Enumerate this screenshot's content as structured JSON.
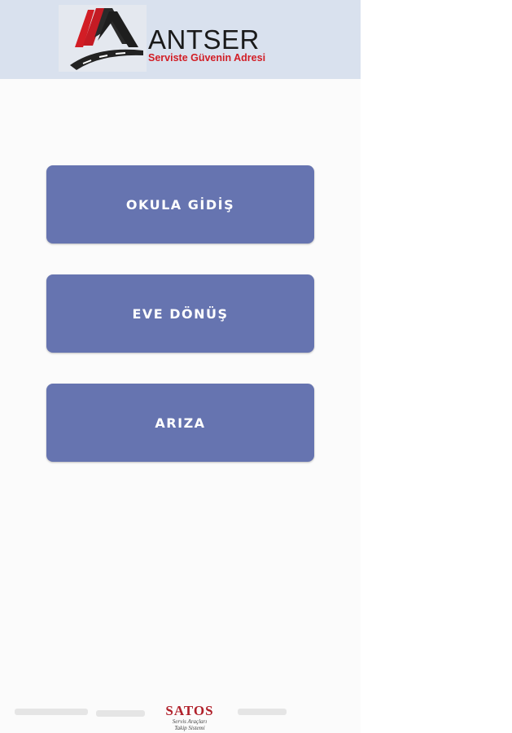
{
  "header": {
    "brand_name": "ANTSER",
    "slogan": "Serviste Güvenin Adresi",
    "logo_icon": "road-logo-icon"
  },
  "actions": [
    {
      "label": "OKULA GİDİŞ"
    },
    {
      "label": "EVE DÖNÜŞ"
    },
    {
      "label": "ARIZA"
    }
  ],
  "footer": {
    "logo_title": "SATOS",
    "logo_sub1": "Servis Araçları",
    "logo_sub2": "Takip Sistemi"
  },
  "colors": {
    "header_bg": "#d9e1ee",
    "button_bg": "#6674b0",
    "brand_red": "#d21d25"
  }
}
